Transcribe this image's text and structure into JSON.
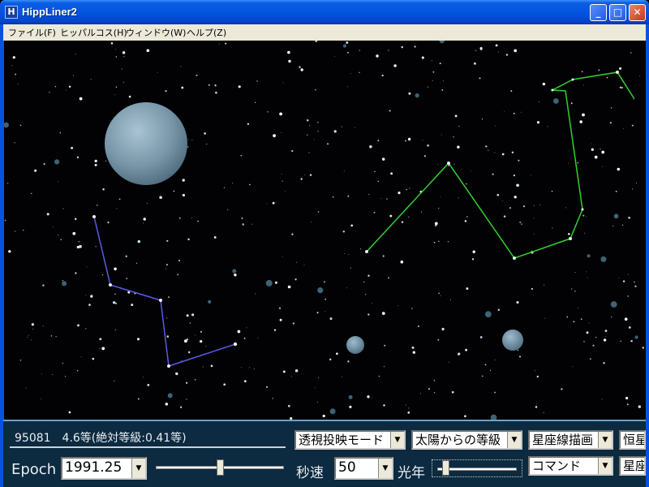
{
  "window": {
    "title": "HippLiner2",
    "icon_letter": "H"
  },
  "title_buttons": {
    "minimize": "_",
    "maximize": "□",
    "close": "✕"
  },
  "menu": [
    {
      "label": "ファイル(F)"
    },
    {
      "label": "ヒッパルコス(H)"
    },
    {
      "label": "ウィンドウ(W)"
    },
    {
      "label": "ヘルプ(Z)"
    }
  ],
  "panel": {
    "star_info": "95081　4.6等(絶対等級:0.41等)",
    "epoch_label": "Epoch",
    "epoch_value": "1991.25",
    "speed_label": "秒速",
    "speed_value": "50",
    "lightyear_label": "光年",
    "epoch_slider_level": 0.5,
    "lightyear_slider_level": 0.1,
    "projection_mode": "透視投映モード",
    "magnitude_mode": "太陽からの等級",
    "constellation_lines": "星座線描画",
    "star_name_partial": "恒星",
    "command": "コマンド",
    "star_partial": "星座"
  },
  "colors": {
    "titlebar": "#0554de",
    "panel_bg": "#0c2a40",
    "constellation_green": "#2fd22f",
    "constellation_blue": "#5a5ae6",
    "planet": "#7fa3b6"
  }
}
